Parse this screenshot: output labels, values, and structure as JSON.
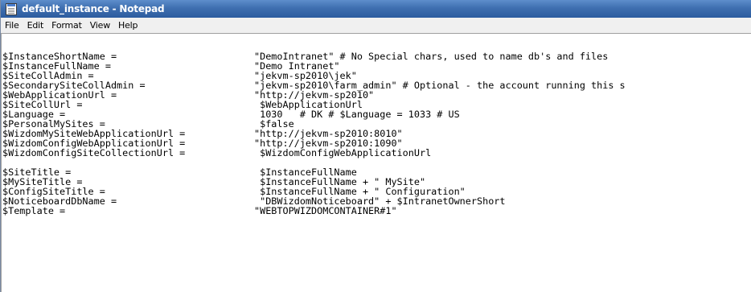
{
  "window": {
    "title": "default_instance - Notepad",
    "icon": "notepad-icon"
  },
  "menu": [
    "File",
    "Edit",
    "Format",
    "View",
    "Help"
  ],
  "editor": {
    "lines": [
      {
        "lhs": "$InstanceShortName =",
        "rhs": "\"DemoIntranet\" # No Special chars, used to name db's and files"
      },
      {
        "lhs": "$InstanceFullName =",
        "rhs": "\"Demo Intranet\""
      },
      {
        "lhs": "$SiteCollAdmin =",
        "rhs": "\"jekvm-sp2010\\jek\""
      },
      {
        "lhs": "$SecondarySiteCollAdmin =",
        "rhs": "\"jekvm-sp2010\\farm_admin\" # Optional - the account running this s"
      },
      {
        "lhs": "$WebApplicationUrl =",
        "rhs": "\"http://jekvm-sp2010\""
      },
      {
        "lhs": "$SiteCollUrl =",
        "rhs": " $WebApplicationUrl"
      },
      {
        "lhs": "$Language =",
        "rhs": " 1030   # DK # $Language = 1033 # US"
      },
      {
        "lhs": "$PersonalMySites =",
        "rhs": " $false"
      },
      {
        "lhs": "$WizdomMySiteWebApplicationUrl =",
        "rhs": "\"http://jekvm-sp2010:8010\""
      },
      {
        "lhs": "$WizdomConfigWebApplicationUrl =",
        "rhs": "\"http://jekvm-sp2010:1090\""
      },
      {
        "lhs": "$WizdomConfigSiteCollectionUrl =",
        "rhs": " $WizdomConfigWebApplicationUrl"
      },
      {
        "lhs": "",
        "rhs": ""
      },
      {
        "lhs": "$SiteTitle =",
        "rhs": " $InstanceFullName"
      },
      {
        "lhs": "$MySiteTitle =",
        "rhs": " $InstanceFullName + \" MySite\""
      },
      {
        "lhs": "$ConfigSiteTitle =",
        "rhs": " $InstanceFullName + \" Configuration\""
      },
      {
        "lhs": "$NoticeboardDbName =",
        "rhs": " \"DBWizdomNoticeboard\" + $IntranetOwnerShort"
      },
      {
        "lhs": "$Template =",
        "rhs": "\"WEBTOPWIZDOMCONTAINER#1\""
      }
    ]
  },
  "colors": {
    "titlebar": "#3f6fb0",
    "menubar": "#f0f0f0",
    "editor_bg": "#ffffff",
    "text": "#000000"
  }
}
